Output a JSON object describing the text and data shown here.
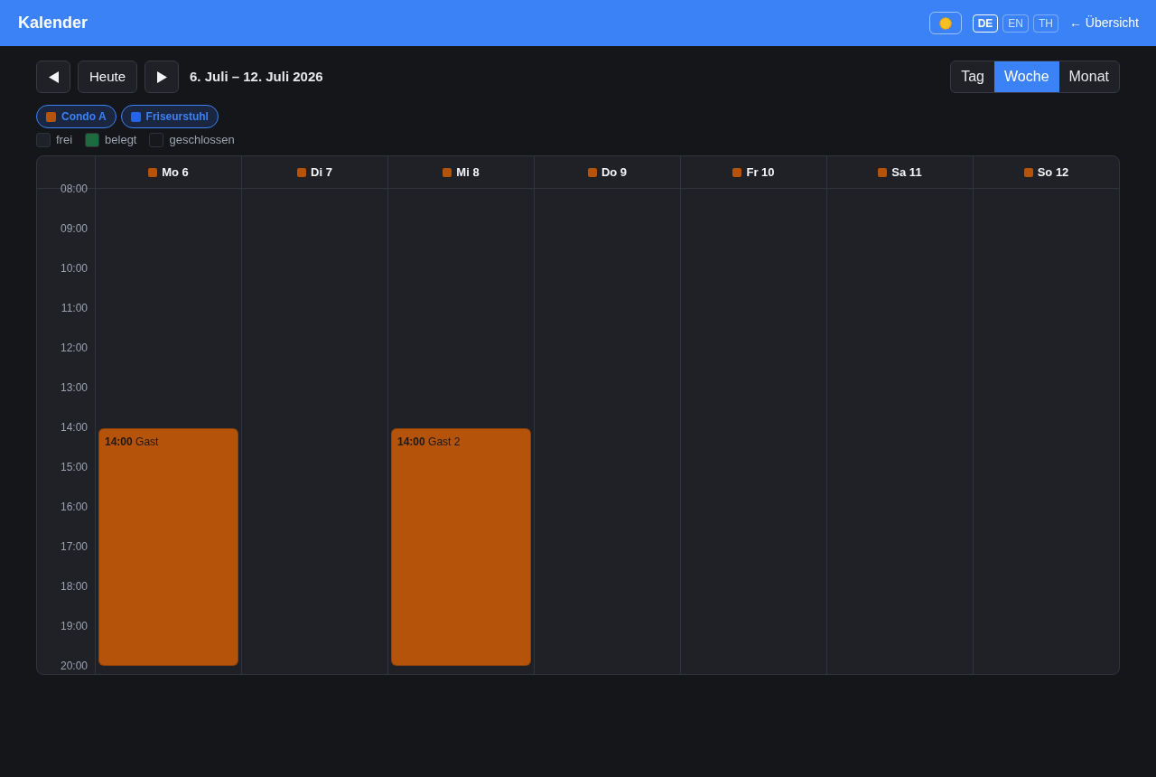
{
  "header": {
    "title": "Kalender",
    "languages": [
      {
        "label": "DE",
        "selected": true
      },
      {
        "label": "EN",
        "selected": false
      },
      {
        "label": "TH",
        "selected": false
      }
    ],
    "back_link": "← Übersicht"
  },
  "toolbar": {
    "today": "Heute",
    "range": "6. Juli – 12. Juli 2026",
    "views": [
      {
        "label": "Tag",
        "selected": false
      },
      {
        "label": "Woche",
        "selected": true
      },
      {
        "label": "Monat",
        "selected": false
      }
    ]
  },
  "resources": [
    {
      "label": "Condo A",
      "color": "#b45309",
      "selected": true
    },
    {
      "label": "Friseurstuhl",
      "color": "#2563eb",
      "selected": true
    }
  ],
  "legend": [
    {
      "label": "frei",
      "color": "#1f2228"
    },
    {
      "label": "belegt",
      "color": "#1d6b3f"
    },
    {
      "label": "geschlossen",
      "color": "#16181c"
    }
  ],
  "calendar": {
    "times": [
      "08:00",
      "09:00",
      "10:00",
      "11:00",
      "12:00",
      "13:00",
      "14:00",
      "15:00",
      "16:00",
      "17:00",
      "18:00",
      "19:00",
      "20:00"
    ],
    "days": [
      {
        "label": "Mo 6",
        "color": "#b45309",
        "events": [
          {
            "time": "14:00",
            "title": "Gast",
            "color": "#b45309"
          }
        ]
      },
      {
        "label": "Di 7",
        "color": "#b45309"
      },
      {
        "label": "Mi 8",
        "color": "#b45309",
        "events": [
          {
            "time": "14:00",
            "title": "Gast 2",
            "color": "#b45309"
          }
        ]
      },
      {
        "label": "Do 9",
        "color": "#b45309"
      },
      {
        "label": "Fr 10",
        "color": "#b45309"
      },
      {
        "label": "Sa 11",
        "color": "#b45309"
      },
      {
        "label": "So 12",
        "color": "#b45309"
      }
    ]
  }
}
